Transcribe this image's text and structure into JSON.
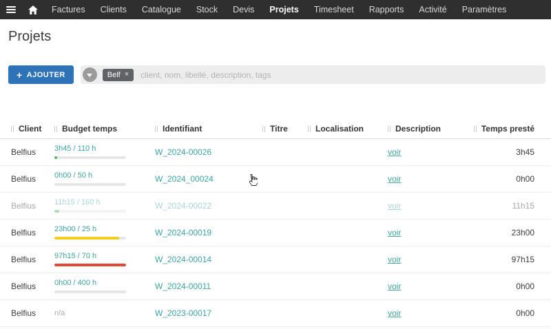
{
  "navbar": {
    "items": [
      {
        "label": "Factures",
        "active": false
      },
      {
        "label": "Clients",
        "active": false
      },
      {
        "label": "Catalogue",
        "active": false
      },
      {
        "label": "Stock",
        "active": false
      },
      {
        "label": "Devis",
        "active": false
      },
      {
        "label": "Projets",
        "active": true
      },
      {
        "label": "Timesheet",
        "active": false
      },
      {
        "label": "Rapports",
        "active": false
      },
      {
        "label": "Activité",
        "active": false
      },
      {
        "label": "Paramètres",
        "active": false
      }
    ]
  },
  "page": {
    "title": "Projets"
  },
  "toolbar": {
    "add_button_icon": "+",
    "add_button_label": "AJOUTER",
    "filter_tag": "Belf",
    "tag_close": "×",
    "search_placeholder": "client, nom, libellé, description, tags"
  },
  "colors": {
    "accent_blue": "#2e73b8",
    "link_teal": "#3fa3a3",
    "bar_green": "#55b559",
    "bar_yellow": "#f2cf1d",
    "bar_red": "#e0483c"
  },
  "table": {
    "columns": [
      "Client",
      "Budget temps",
      "Identifiant",
      "Titre",
      "Localisation",
      "Description",
      "Temps presté"
    ],
    "rows": [
      {
        "client": "Belfius",
        "budget": "3h45 / 110 h",
        "identifiant": "W_2024-00026",
        "titre": "",
        "localisation": "",
        "description": "voir",
        "temps": "3h45",
        "bar": {
          "pct": 4,
          "color": "#55b559"
        },
        "faded": false
      },
      {
        "client": "Belfius",
        "budget": "0h00 / 50 h",
        "identifiant": "W_2024_00024",
        "titre": "",
        "localisation": "",
        "description": "voir",
        "temps": "0h00",
        "bar": {
          "pct": 0,
          "color": "#55b559"
        },
        "faded": false
      },
      {
        "client": "Belfius",
        "budget": "11h15 / 160 h",
        "identifiant": "W_2024-00022",
        "titre": "",
        "localisation": "",
        "description": "voir",
        "temps": "11h15",
        "bar": {
          "pct": 7,
          "color": "#55b559"
        },
        "faded": true
      },
      {
        "client": "Belfius",
        "budget": "23h00 / 25 h",
        "identifiant": "W_2024-00019",
        "titre": "",
        "localisation": "",
        "description": "voir",
        "temps": "23h00",
        "bar": {
          "pct": 90,
          "color": "#f2cf1d"
        },
        "faded": false
      },
      {
        "client": "Belfius",
        "budget": "97h15 / 70 h",
        "identifiant": "W_2024-00014",
        "titre": "",
        "localisation": "",
        "description": "voir",
        "temps": "97h15",
        "bar": {
          "pct": 100,
          "color": "#e0483c"
        },
        "faded": false
      },
      {
        "client": "Belfius",
        "budget": "0h00 / 400 h",
        "identifiant": "W_2024-00011",
        "titre": "",
        "localisation": "",
        "description": "voir",
        "temps": "0h00",
        "bar": {
          "pct": 0,
          "color": "#55b559"
        },
        "faded": false
      },
      {
        "client": "Belfius",
        "budget": "n/a",
        "identifiant": "W_2023-00017",
        "titre": "",
        "localisation": "",
        "description": "voir",
        "temps": "0h00",
        "bar": null,
        "faded": false
      }
    ]
  }
}
